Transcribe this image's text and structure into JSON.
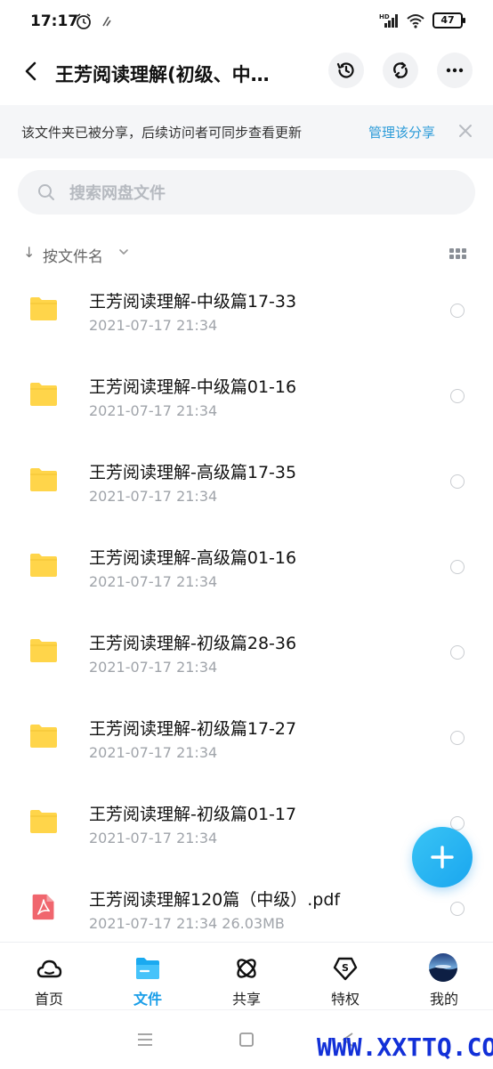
{
  "status_bar": {
    "time": "17:17",
    "hd_label": "HD",
    "battery": "47"
  },
  "header": {
    "title": "王芳阅读理解(初级、中…",
    "back_icon": "back-arrow-icon",
    "history_icon": "history-icon",
    "sync_icon": "sync-icon",
    "more_icon": "more-dots-icon"
  },
  "share_banner": {
    "text": "该文件夹已被分享，后续访问者可同步查看更新",
    "manage_link": "管理该分享",
    "close_icon": "close-icon"
  },
  "search": {
    "placeholder": "搜索网盘文件",
    "value": ""
  },
  "sort": {
    "label": "按文件名"
  },
  "files": [
    {
      "name": "王芳阅读理解-中级篇17-33",
      "meta": "2021-07-17  21:34",
      "type": "folder"
    },
    {
      "name": "王芳阅读理解-中级篇01-16",
      "meta": "2021-07-17  21:34",
      "type": "folder"
    },
    {
      "name": "王芳阅读理解-高级篇17-35",
      "meta": "2021-07-17  21:34",
      "type": "folder"
    },
    {
      "name": "王芳阅读理解-高级篇01-16",
      "meta": "2021-07-17  21:34",
      "type": "folder"
    },
    {
      "name": "王芳阅读理解-初级篇28-36",
      "meta": "2021-07-17  21:34",
      "type": "folder"
    },
    {
      "name": "王芳阅读理解-初级篇17-27",
      "meta": "2021-07-17  21:34",
      "type": "folder"
    },
    {
      "name": "王芳阅读理解-初级篇01-17",
      "meta": "2021-07-17  21:34",
      "type": "folder"
    },
    {
      "name": "王芳阅读理解120篇（中级）.pdf",
      "meta": "2021-07-17  21:34   26.03MB",
      "type": "pdf"
    }
  ],
  "bottom_nav": [
    {
      "label": "首页",
      "icon": "cloud-icon"
    },
    {
      "label": "文件",
      "icon": "folder-icon",
      "active": true
    },
    {
      "label": "共享",
      "icon": "share-atom-icon"
    },
    {
      "label": "特权",
      "icon": "privilege-badge-icon"
    },
    {
      "label": "我的",
      "icon": "avatar-icon"
    }
  ],
  "watermark": "WWW.XXTTQ.COM",
  "colors": {
    "accent": "#1a9ee8",
    "folder": "#ffd54a",
    "pdf": "#f0666e",
    "banner_bg": "#f5f6f8"
  }
}
